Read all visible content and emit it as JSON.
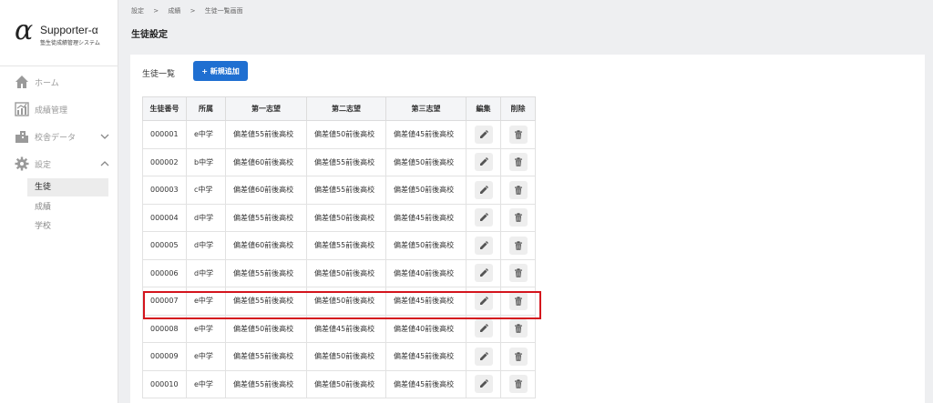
{
  "app": {
    "logo_symbol": "α",
    "logo_name": "Supporter-α",
    "logo_sub": "塾生徒成績管理システム"
  },
  "sidebar": {
    "items": [
      {
        "label": "ホーム",
        "icon": "home-icon"
      },
      {
        "label": "成績管理",
        "icon": "chart-icon"
      },
      {
        "label": "校舎データ",
        "icon": "building-icon"
      },
      {
        "label": "設定",
        "icon": "gear-icon"
      }
    ],
    "sub_items": [
      {
        "label": "生徒",
        "active": true
      },
      {
        "label": "成績",
        "active": false
      },
      {
        "label": "学校",
        "active": false
      }
    ]
  },
  "breadcrumb": [
    "設定",
    ">",
    "成績",
    ">",
    "生徒一覧画面"
  ],
  "page_title": "生徒設定",
  "main": {
    "list_title": "生徒一覧",
    "add_button": "+ 新規追加"
  },
  "table": {
    "headers": [
      "生徒番号",
      "所属",
      "第一志望",
      "第二志望",
      "第三志望",
      "編集",
      "削除"
    ],
    "rows": [
      [
        "000001",
        "e中学",
        "偏差値55前後高校",
        "偏差値50前後高校",
        "偏差値45前後高校"
      ],
      [
        "000002",
        "b中学",
        "偏差値60前後高校",
        "偏差値55前後高校",
        "偏差値50前後高校"
      ],
      [
        "000003",
        "c中学",
        "偏差値60前後高校",
        "偏差値55前後高校",
        "偏差値50前後高校"
      ],
      [
        "000004",
        "d中学",
        "偏差値55前後高校",
        "偏差値50前後高校",
        "偏差値45前後高校"
      ],
      [
        "000005",
        "d中学",
        "偏差値60前後高校",
        "偏差値55前後高校",
        "偏差値50前後高校"
      ],
      [
        "000006",
        "d中学",
        "偏差値55前後高校",
        "偏差値50前後高校",
        "偏差値40前後高校"
      ],
      [
        "000007",
        "e中学",
        "偏差値55前後高校",
        "偏差値50前後高校",
        "偏差値45前後高校"
      ],
      [
        "000008",
        "e中学",
        "偏差値50前後高校",
        "偏差値45前後高校",
        "偏差値40前後高校"
      ],
      [
        "000009",
        "e中学",
        "偏差値55前後高校",
        "偏差値50前後高校",
        "偏差値45前後高校"
      ],
      [
        "000010",
        "e中学",
        "偏差値55前後高校",
        "偏差値50前後高校",
        "偏差値45前後高校"
      ]
    ],
    "highlighted_row": "000007"
  },
  "colors": {
    "accent": "#1f6fd1",
    "highlight": "#d4141d"
  }
}
